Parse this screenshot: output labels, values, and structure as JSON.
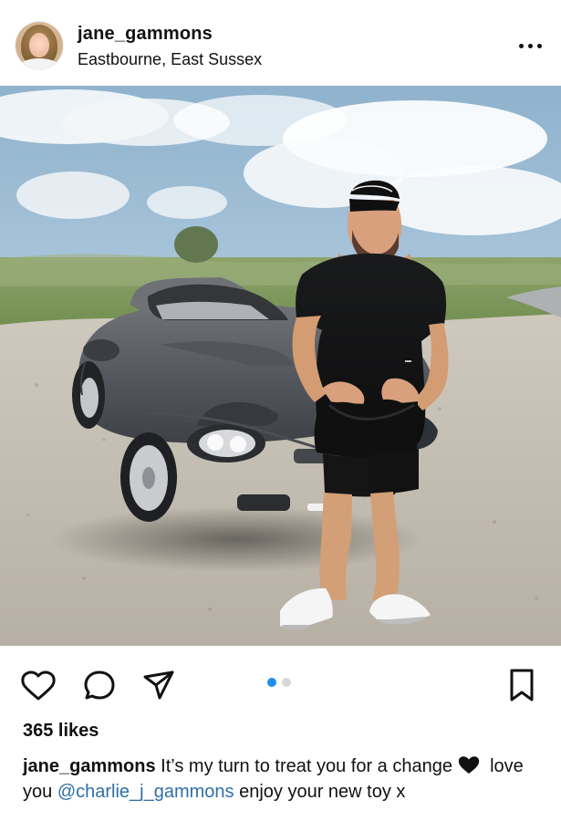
{
  "post": {
    "username": "jane_gammons",
    "location": "Eastbourne, East Sussex",
    "likes": "365 likes",
    "caption_text_1": " It’s my turn to treat you for a change ",
    "caption_text_2": " love you ",
    "mention": "@charlie_j_gammons",
    "caption_text_3": " enjoy your new toy x",
    "carousel_dots": {
      "active": 1,
      "total": 2
    },
    "icons": {
      "more": "more-options-icon",
      "like": "heart-icon",
      "comment": "comment-icon",
      "share": "share-icon",
      "save": "bookmark-icon",
      "emoji": "black-heart-emoji"
    },
    "colors": {
      "active_dot": "#1f8ef1",
      "inactive_dot": "#d8d8d8",
      "mention": "#2f6fa8"
    }
  }
}
